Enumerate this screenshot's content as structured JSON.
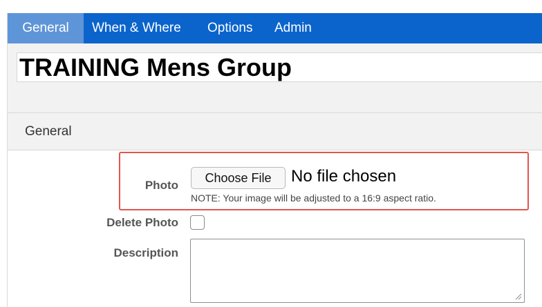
{
  "tabs": [
    {
      "label": "General",
      "active": true
    },
    {
      "label": "When & Where",
      "active": false
    },
    {
      "label": "Options",
      "active": false
    },
    {
      "label": "Admin",
      "active": false
    }
  ],
  "title_field": {
    "value": "TRAINING Mens Group"
  },
  "section": {
    "title": "General"
  },
  "photo": {
    "label": "Photo",
    "button_label": "Choose File",
    "status": "No file chosen",
    "note": "NOTE: Your image will be adjusted to a 16:9 aspect ratio."
  },
  "delete_photo": {
    "label": "Delete Photo",
    "checked": false
  },
  "description": {
    "label": "Description",
    "value": ""
  },
  "colors": {
    "tab_bar": "#0b64cc",
    "active_tab": "#5e95d8",
    "highlight_border": "#e2544b",
    "panel_background": "#f2f2f2"
  },
  "icons": {
    "textarea_resize": "resize-grip-icon"
  }
}
